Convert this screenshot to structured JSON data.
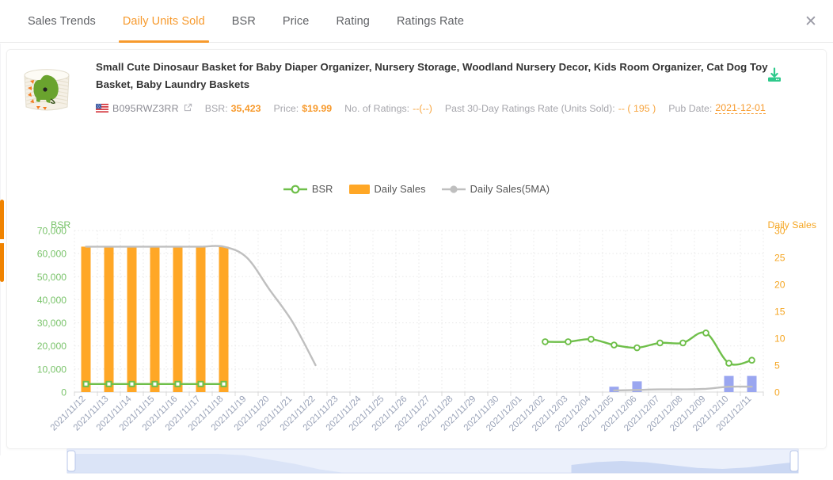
{
  "tabs": [
    {
      "label": "Sales Trends",
      "active": false
    },
    {
      "label": "Daily Units Sold",
      "active": true
    },
    {
      "label": "BSR",
      "active": false
    },
    {
      "label": "Price",
      "active": false
    },
    {
      "label": "Rating",
      "active": false
    },
    {
      "label": "Ratings Rate",
      "active": false
    }
  ],
  "close_label": "✕",
  "product": {
    "title": "Small Cute Dinosaur Basket for Baby Diaper Organizer, Nursery Storage, Woodland Nursery Decor, Kids Room Organizer, Cat Dog Toy Basket, Baby Laundry Baskets",
    "marketplace_flag": "us-flag-icon",
    "asin": "B095RWZ3RR",
    "external_link_icon": "external-link-icon",
    "download_icon": "download-icon",
    "meta": {
      "bsr_label": "BSR:",
      "bsr_value": "35,423",
      "price_label": "Price:",
      "price_value": "$19.99",
      "ratings_label": "No. of Ratings:",
      "ratings_value": "--(--)",
      "rate_label": "Past 30-Day Ratings Rate (Units Sold):",
      "rate_value": "-- ( 195 )",
      "pub_label": "Pub Date:",
      "pub_value": "2021-12-01"
    }
  },
  "legend": [
    {
      "name": "BSR",
      "type": "line-marker",
      "color": "#6fbf4a"
    },
    {
      "name": "Daily Sales",
      "type": "bar",
      "color": "#ffa726"
    },
    {
      "name": "Daily Sales(5MA)",
      "type": "line-dot",
      "color": "#bfbfbf"
    }
  ],
  "colors": {
    "accent": "#f79a2d",
    "bsr_green": "#6fbf4a",
    "bar_orange": "#ffa726",
    "bar_blue": "#9aa6f0",
    "ma_gray": "#bfbfbf",
    "grid": "#e8e8e8",
    "slider_fill": "#d6e0f7"
  },
  "chart_data": {
    "type": "bar",
    "title": "",
    "xlabel": "",
    "ylabel": "BSR",
    "y2label": "Daily Sales",
    "grid": true,
    "legend_position": "top-center",
    "ylim": [
      0,
      70000
    ],
    "y2lim": [
      0,
      30
    ],
    "yticks": [
      "0",
      "10,000",
      "20,000",
      "30,000",
      "40,000",
      "50,000",
      "60,000",
      "70,000"
    ],
    "y2ticks": [
      "0",
      "5",
      "10",
      "15",
      "20",
      "25",
      "30"
    ],
    "categories": [
      "2021/11/12",
      "2021/11/13",
      "2021/11/14",
      "2021/11/15",
      "2021/11/16",
      "2021/11/17",
      "2021/11/18",
      "2021/11/19",
      "2021/11/20",
      "2021/11/21",
      "2021/11/22",
      "2021/11/23",
      "2021/11/24",
      "2021/11/25",
      "2021/11/26",
      "2021/11/27",
      "2021/11/28",
      "2021/11/29",
      "2021/11/30",
      "2021/12/01",
      "2021/12/02",
      "2021/12/03",
      "2021/12/04",
      "2021/12/05",
      "2021/12/06",
      "2021/12/07",
      "2021/12/08",
      "2021/12/09",
      "2021/12/10",
      "2021/12/11"
    ],
    "series": [
      {
        "name": "Daily Sales",
        "type": "bar",
        "axis": "y2",
        "color": "#ffa726",
        "values": [
          27,
          27,
          27,
          27,
          27,
          27,
          27,
          null,
          null,
          null,
          null,
          null,
          null,
          null,
          null,
          null,
          null,
          null,
          null,
          null,
          null,
          null,
          null,
          1,
          2,
          null,
          null,
          null,
          3,
          3
        ]
      },
      {
        "name": "Daily Sales(5MA)",
        "type": "line",
        "axis": "y2",
        "color": "#bfbfbf",
        "values": [
          27,
          27,
          27,
          27,
          27,
          27,
          27,
          25,
          19,
          13,
          5,
          null,
          null,
          null,
          null,
          null,
          null,
          null,
          null,
          null,
          null,
          null,
          null,
          0.3,
          0.4,
          0.5,
          0.5,
          0.6,
          1.0,
          1.0
        ]
      },
      {
        "name": "BSR",
        "type": "line",
        "axis": "y1",
        "color": "#6fbf4a",
        "values": [
          3500,
          3500,
          3500,
          3500,
          3500,
          3500,
          3500,
          null,
          null,
          null,
          null,
          null,
          null,
          null,
          null,
          null,
          null,
          null,
          null,
          null,
          21800,
          21800,
          22900,
          20400,
          19200,
          21300,
          21300,
          25600,
          12500,
          13800
        ]
      }
    ],
    "data_zoom": {
      "start_pct": 0,
      "end_pct": 100
    }
  }
}
